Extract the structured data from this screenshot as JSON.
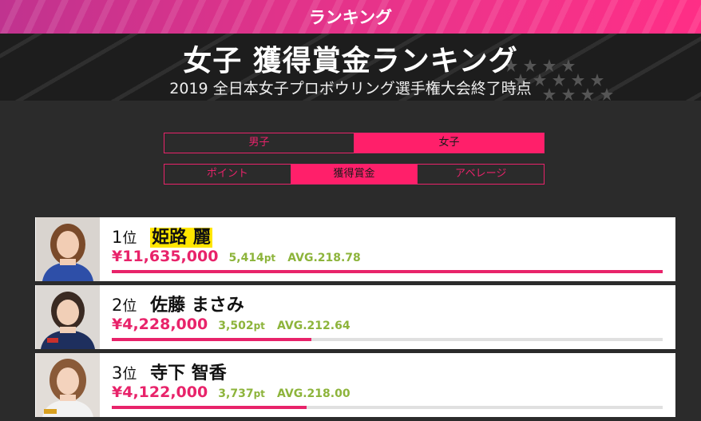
{
  "header": {
    "title": "ランキング"
  },
  "banner": {
    "title": "女子 獲得賞金ランキング",
    "subtitle": "2019 全日本女子プロボウリング選手権大会終了時点"
  },
  "gender_tabs": [
    {
      "label": "男子",
      "active": false
    },
    {
      "label": "女子",
      "active": true
    }
  ],
  "category_tabs": [
    {
      "label": "ポイント",
      "active": false
    },
    {
      "label": "獲得賞金",
      "active": true
    },
    {
      "label": "アベレージ",
      "active": false
    }
  ],
  "rank_suffix": "位",
  "pt_unit": "pt",
  "rankings": [
    {
      "rank": "1",
      "name": "姫路 麗",
      "prize": "¥11,635,000",
      "points": "5,414",
      "avg": "AVG.218.78",
      "bar_fraction": 1.0,
      "highlight": true
    },
    {
      "rank": "2",
      "name": "佐藤 まさみ",
      "prize": "¥4,228,000",
      "points": "3,502",
      "avg": "AVG.212.64",
      "bar_fraction": 0.363,
      "highlight": false
    },
    {
      "rank": "3",
      "name": "寺下 智香",
      "prize": "¥4,122,000",
      "points": "3,737",
      "avg": "AVG.218.00",
      "bar_fraction": 0.354,
      "highlight": false
    }
  ],
  "colors": {
    "accent": "#e8236a",
    "accent_active": "#ff1f6a",
    "stats_green": "#8db43b",
    "highlight": "#ffe600"
  }
}
